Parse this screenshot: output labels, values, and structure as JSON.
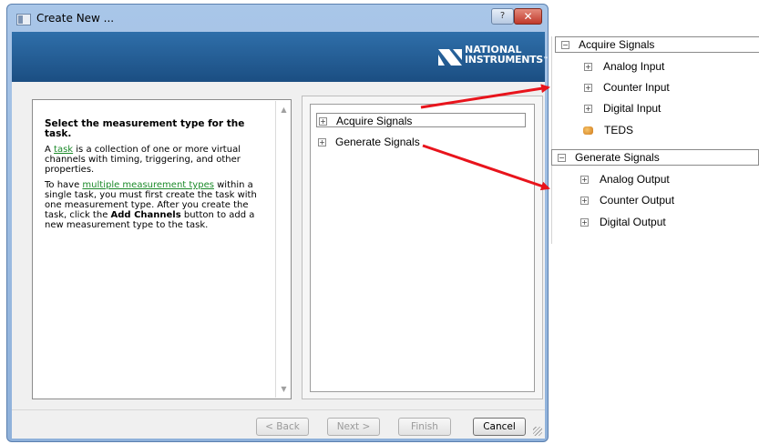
{
  "window": {
    "title": "Create New ...",
    "help_glyph": "?",
    "close_glyph": "✕"
  },
  "banner": {
    "logo_line1": "NATIONAL",
    "logo_line2": "INSTRUMENTS",
    "logo_trademark": "™"
  },
  "info": {
    "title": "Select the measurement type for the task.",
    "p1_prefix": "A ",
    "p1_link": "task",
    "p1_suffix": " is a collection of one or more virtual channels with timing, triggering, and other properties.",
    "p2_prefix": "To have ",
    "p2_link": "multiple measurement types",
    "p2_mid": " within a single task, you must first create the task with one measurement type. After you create the task, click the ",
    "p2_bold": "Add Channels",
    "p2_suffix": " button to add a new measurement type to the task."
  },
  "tree": {
    "expander_glyph": "+",
    "items": [
      {
        "label": "Acquire Signals"
      },
      {
        "label": "Generate Signals"
      }
    ]
  },
  "footer": {
    "back": "< Back",
    "next": "Next >",
    "finish": "Finish",
    "cancel": "Cancel"
  },
  "acquire_group": {
    "header": "Acquire Signals",
    "collapse_glyph": "−",
    "items": [
      {
        "label": "Analog Input"
      },
      {
        "label": "Counter Input"
      },
      {
        "label": "Digital Input"
      },
      {
        "label": "TEDS"
      }
    ]
  },
  "generate_group": {
    "header": "Generate Signals",
    "collapse_glyph": "−",
    "items": [
      {
        "label": "Analog Output"
      },
      {
        "label": "Counter Output"
      },
      {
        "label": "Digital Output"
      }
    ]
  },
  "colors": {
    "arrow": "#e8141c",
    "banner": "#1b4e82",
    "link": "#1c8a2a"
  },
  "icons": {
    "window": "window-icon",
    "teds": "teds-icon",
    "logo": "national-instruments-logo-icon"
  }
}
